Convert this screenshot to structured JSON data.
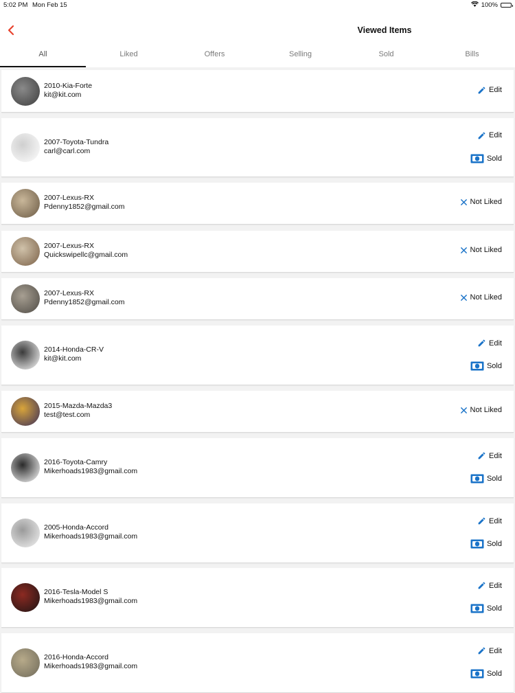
{
  "status_bar": {
    "time": "5:02 PM",
    "date": "Mon Feb 15",
    "battery": "100%",
    "battery_level": 1.0
  },
  "header": {
    "title": "Viewed Items",
    "back_icon": "chevron-left-icon"
  },
  "colors": {
    "accent": "#e8432e",
    "icon_blue": "#1a73c8",
    "tab_active_underline": "#111111"
  },
  "tabs": [
    {
      "label": "All",
      "active": true
    },
    {
      "label": "Liked",
      "active": false
    },
    {
      "label": "Offers",
      "active": false
    },
    {
      "label": "Selling",
      "active": false
    },
    {
      "label": "Sold",
      "active": false
    },
    {
      "label": "Bills",
      "active": false
    }
  ],
  "items": [
    {
      "title": "2010-Kia-Forte",
      "email": "kit@kit.com",
      "actions": [
        {
          "label": "Edit",
          "icon": "pencil-icon"
        }
      ],
      "thumb_colors": [
        "#3d3d3d",
        "#8a8a8a"
      ]
    },
    {
      "title": "2007-Toyota-Tundra",
      "email": "carl@carl.com",
      "actions": [
        {
          "label": "Edit",
          "icon": "pencil-icon"
        },
        {
          "label": "Sold",
          "icon": "money-icon"
        }
      ],
      "thumb_colors": [
        "#ffffff",
        "#cfcfcf"
      ]
    },
    {
      "title": "2007-Lexus-RX",
      "email": "Pdenny1852@gmail.com",
      "actions": [
        {
          "label": "Not Liked",
          "icon": "close-icon"
        }
      ],
      "thumb_colors": [
        "#6b5a44",
        "#c9b79a"
      ]
    },
    {
      "title": "2007-Lexus-RX",
      "email": "Quickswipellc@gmail.com",
      "actions": [
        {
          "label": "Not Liked",
          "icon": "close-icon"
        }
      ],
      "thumb_colors": [
        "#7b6148",
        "#d0c2aa"
      ]
    },
    {
      "title": "2007-Lexus-RX",
      "email": "Pdenny1852@gmail.com",
      "actions": [
        {
          "label": "Not Liked",
          "icon": "close-icon"
        }
      ],
      "thumb_colors": [
        "#4e4a44",
        "#a79f92"
      ]
    },
    {
      "title": "2014-Honda-CR-V",
      "email": "kit@kit.com",
      "actions": [
        {
          "label": "Edit",
          "icon": "pencil-icon"
        },
        {
          "label": "Sold",
          "icon": "money-icon"
        }
      ],
      "thumb_colors": [
        "#ffffff",
        "#3a3a3a"
      ]
    },
    {
      "title": "2015-Mazda-Mazda3",
      "email": "test@test.com",
      "actions": [
        {
          "label": "Not Liked",
          "icon": "close-icon"
        }
      ],
      "thumb_colors": [
        "#3b2f5a",
        "#d9a53a"
      ]
    },
    {
      "title": "2016-Toyota-Camry",
      "email": "Mikerhoads1983@gmail.com",
      "actions": [
        {
          "label": "Edit",
          "icon": "pencil-icon"
        },
        {
          "label": "Sold",
          "icon": "money-icon"
        }
      ],
      "thumb_colors": [
        "#ffffff",
        "#2a2a2a"
      ]
    },
    {
      "title": "2005-Honda-Accord",
      "email": "Mikerhoads1983@gmail.com",
      "actions": [
        {
          "label": "Edit",
          "icon": "pencil-icon"
        },
        {
          "label": "Sold",
          "icon": "money-icon"
        }
      ],
      "thumb_colors": [
        "#f3f3f3",
        "#9a9a9a"
      ]
    },
    {
      "title": "2016-Tesla-Model S",
      "email": "Mikerhoads1983@gmail.com",
      "actions": [
        {
          "label": "Edit",
          "icon": "pencil-icon"
        },
        {
          "label": "Sold",
          "icon": "money-icon"
        }
      ],
      "thumb_colors": [
        "#1c1414",
        "#8c2a22"
      ]
    },
    {
      "title": "2016-Honda-Accord",
      "email": "Mikerhoads1983@gmail.com",
      "actions": [
        {
          "label": "Edit",
          "icon": "pencil-icon"
        },
        {
          "label": "Sold",
          "icon": "money-icon"
        }
      ],
      "thumb_colors": [
        "#6f6a5a",
        "#b7aa8a"
      ]
    }
  ]
}
